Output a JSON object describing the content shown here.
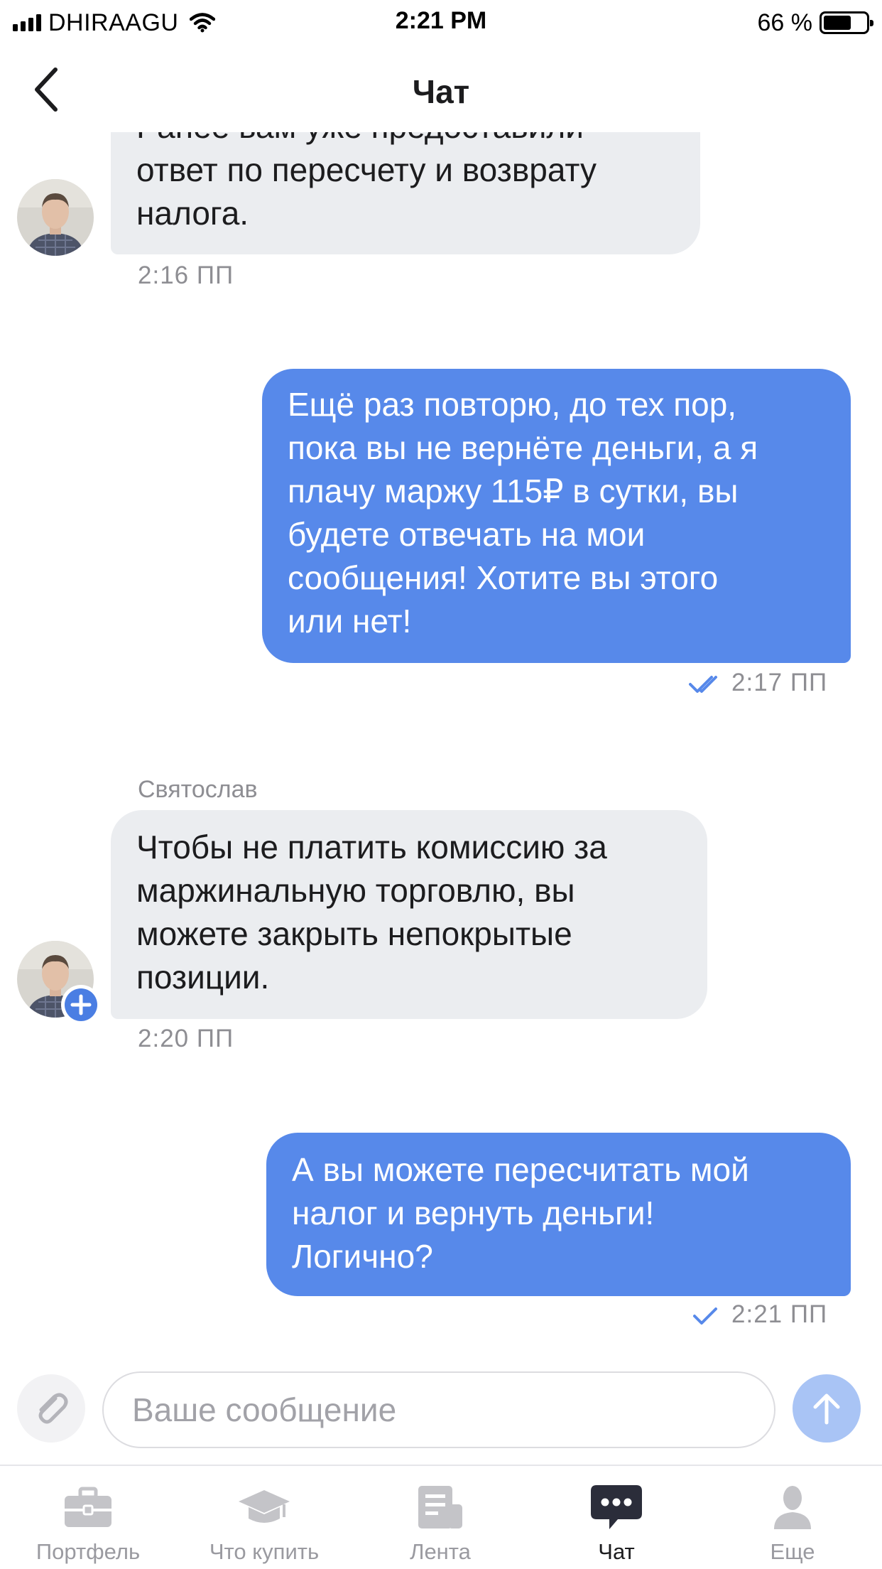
{
  "status_bar": {
    "carrier": "DHIRAAGU",
    "time": "2:21 PM",
    "battery_percent": "66 %",
    "battery_level": 0.66,
    "signal_icon": "signal-bars-icon",
    "wifi_icon": "wifi-icon"
  },
  "nav": {
    "title": "Чат",
    "back_icon": "chevron-left-icon"
  },
  "colors": {
    "incoming_bubble": "#ebedf0",
    "outgoing_bubble": "#5789ea",
    "send_button": "#a9c4f5",
    "read_check": "#5789ea",
    "muted_text": "#8e8e93"
  },
  "messages": [
    {
      "direction": "incoming",
      "lines": [
        "Ранее вам уже предоставили",
        "ответ по пересчету и возврату",
        "налога."
      ],
      "time": "2:16 ПП"
    },
    {
      "direction": "outgoing",
      "lines": [
        "Ещё раз повторю, до тех пор,",
        "пока вы не вернёте деньги, а я",
        "плачу маржу 115₽ в сутки, вы",
        "будете отвечать на мои",
        "сообщения! Хотите вы этого",
        "или нет!"
      ],
      "time": "2:17 ПП",
      "status": "read"
    },
    {
      "direction": "incoming",
      "sender": "Святослав",
      "lines": [
        "Чтобы не платить комиссию за",
        "маржинальную торговлю, вы",
        "можете закрыть непокрытые",
        "позиции."
      ],
      "time": "2:20 ПП"
    },
    {
      "direction": "outgoing",
      "lines": [
        "А вы можете пересчитать мой",
        "налог и вернуть деньги!",
        "Логично?"
      ],
      "time": "2:21 ПП",
      "status": "sent"
    }
  ],
  "composer": {
    "placeholder": "Ваше сообщение",
    "attach_icon": "paperclip-icon",
    "send_icon": "arrow-up-icon"
  },
  "tabs": [
    {
      "label": "Портфель",
      "icon": "briefcase-icon",
      "active": false
    },
    {
      "label": "Что купить",
      "icon": "graduation-cap-icon",
      "active": false
    },
    {
      "label": "Лента",
      "icon": "news-feed-icon",
      "active": false
    },
    {
      "label": "Чат",
      "icon": "chat-bubble-icon",
      "active": true
    },
    {
      "label": "Еще",
      "icon": "person-icon",
      "active": false
    }
  ]
}
